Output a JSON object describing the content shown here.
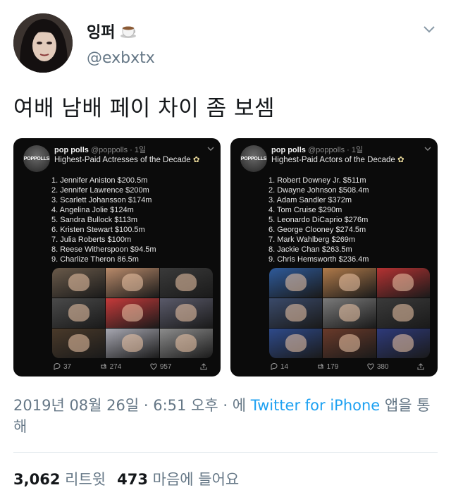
{
  "tweet": {
    "display_name": "잉퍼",
    "handle": "@exbxtx",
    "text": "여배 남배 페이 차이 좀 보셈",
    "timestamp": "2019년 08월 26일 · 6:51 오후 · 에 ",
    "source_link": "Twitter for iPhone",
    "source_suffix": " 앱을 통해",
    "retweets_count": "3,062",
    "retweets_label": "리트윗",
    "likes_count": "473",
    "likes_label": "마음에 들어요",
    "emoji_icon": "coffee-cup-icon",
    "colors": {
      "link": "#1da1f2",
      "muted": "#657786",
      "text": "#14171a",
      "card_bg": "#0b0b0b"
    }
  },
  "embedded_posts": [
    {
      "avatar_text": "POPPOLLS",
      "name": "pop polls",
      "meta": "@poppolls · 1일",
      "title": "Highest-Paid Actresses of the Decade",
      "title_emoji": "✿",
      "items": [
        "1. Jennifer Aniston $200.5m",
        "2. Jennifer Lawrence $200m",
        "3. Scarlett Johansson $174m",
        "4. Angelina Jolie $124m",
        "5. Sandra Bullock $113m",
        "6. Kristen Stewart $100.5m",
        "7. Julia Roberts $100m",
        "8. Reese Witherspoon $94.5m",
        "9. Charlize Theron 86.5m"
      ],
      "replies": "37",
      "retweets": "274",
      "likes": "957",
      "photo_colors": [
        "#6a5a4a",
        "#b98a6a",
        "#3a3a3a",
        "#4a4a4a",
        "#c63a3a",
        "#5a5a6a",
        "#4a3a2a",
        "#a7a7b1",
        "#8c8c8c"
      ]
    },
    {
      "avatar_text": "POPPOLLS",
      "name": "pop polls",
      "meta": "@poppolls · 1일",
      "title": "Highest-Paid Actors of the Decade",
      "title_emoji": "✿",
      "items": [
        "1. Robert Downey Jr. $511m",
        "2. Dwayne Johnson $508.4m",
        "3. Adam Sandler $372m",
        "4. Tom Cruise $290m",
        "5. Leonardo DiCaprio $276m",
        "6. George Clooney $274.5m",
        "7. Mark Wahlberg $269m",
        "8. Jackie Chan $263.5m",
        "9. Chris Hemsworth $236.4m"
      ],
      "replies": "14",
      "retweets": "179",
      "likes": "380",
      "photo_colors": [
        "#2e5a9a",
        "#b07a4a",
        "#b43232",
        "#3a4a6a",
        "#7a7a7a",
        "#3a3a3a",
        "#2e4a8a",
        "#6a3a2a",
        "#2e3a7a"
      ]
    }
  ]
}
